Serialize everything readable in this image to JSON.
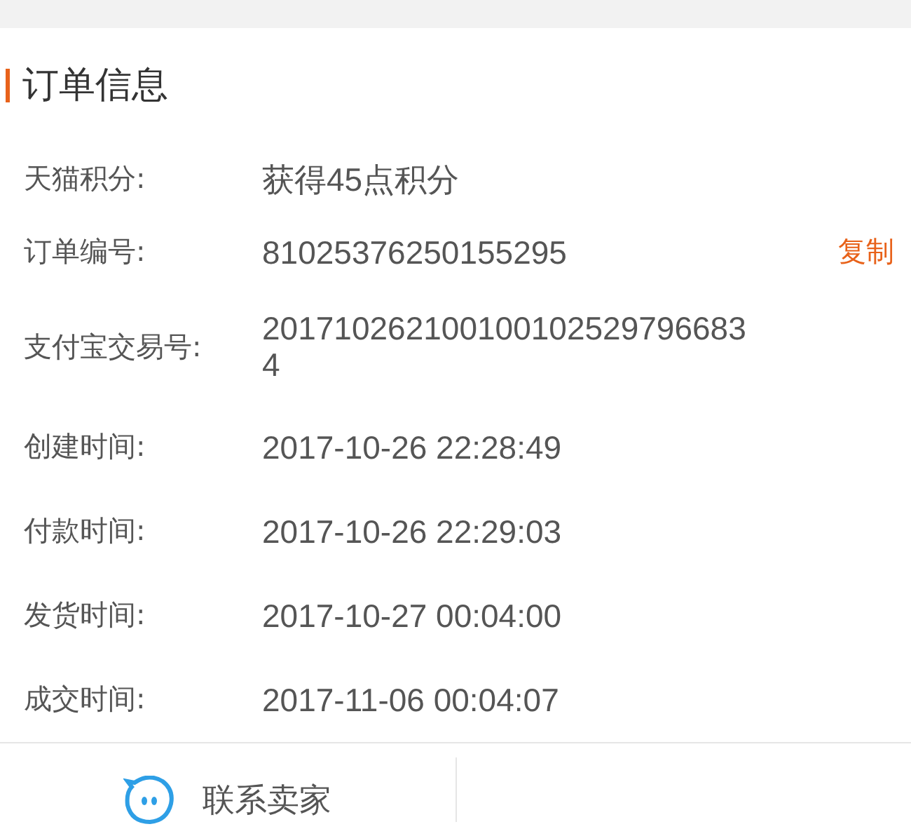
{
  "section": {
    "title": "订单信息"
  },
  "rows": [
    {
      "label": "天猫积分:",
      "value": "获得45点积分"
    },
    {
      "label": "订单编号:",
      "value": "81025376250155295",
      "action": "复制"
    },
    {
      "label": "支付宝交易号:",
      "value": "2017102621001001025297966834"
    },
    {
      "label": "创建时间:",
      "value": "2017-10-26 22:28:49"
    },
    {
      "label": "付款时间:",
      "value": "2017-10-26 22:29:03"
    },
    {
      "label": "发货时间:",
      "value": "2017-10-27 00:04:00"
    },
    {
      "label": "成交时间:",
      "value": "2017-11-06 00:04:07"
    }
  ],
  "footer": {
    "contact_button": "联系卖家"
  }
}
